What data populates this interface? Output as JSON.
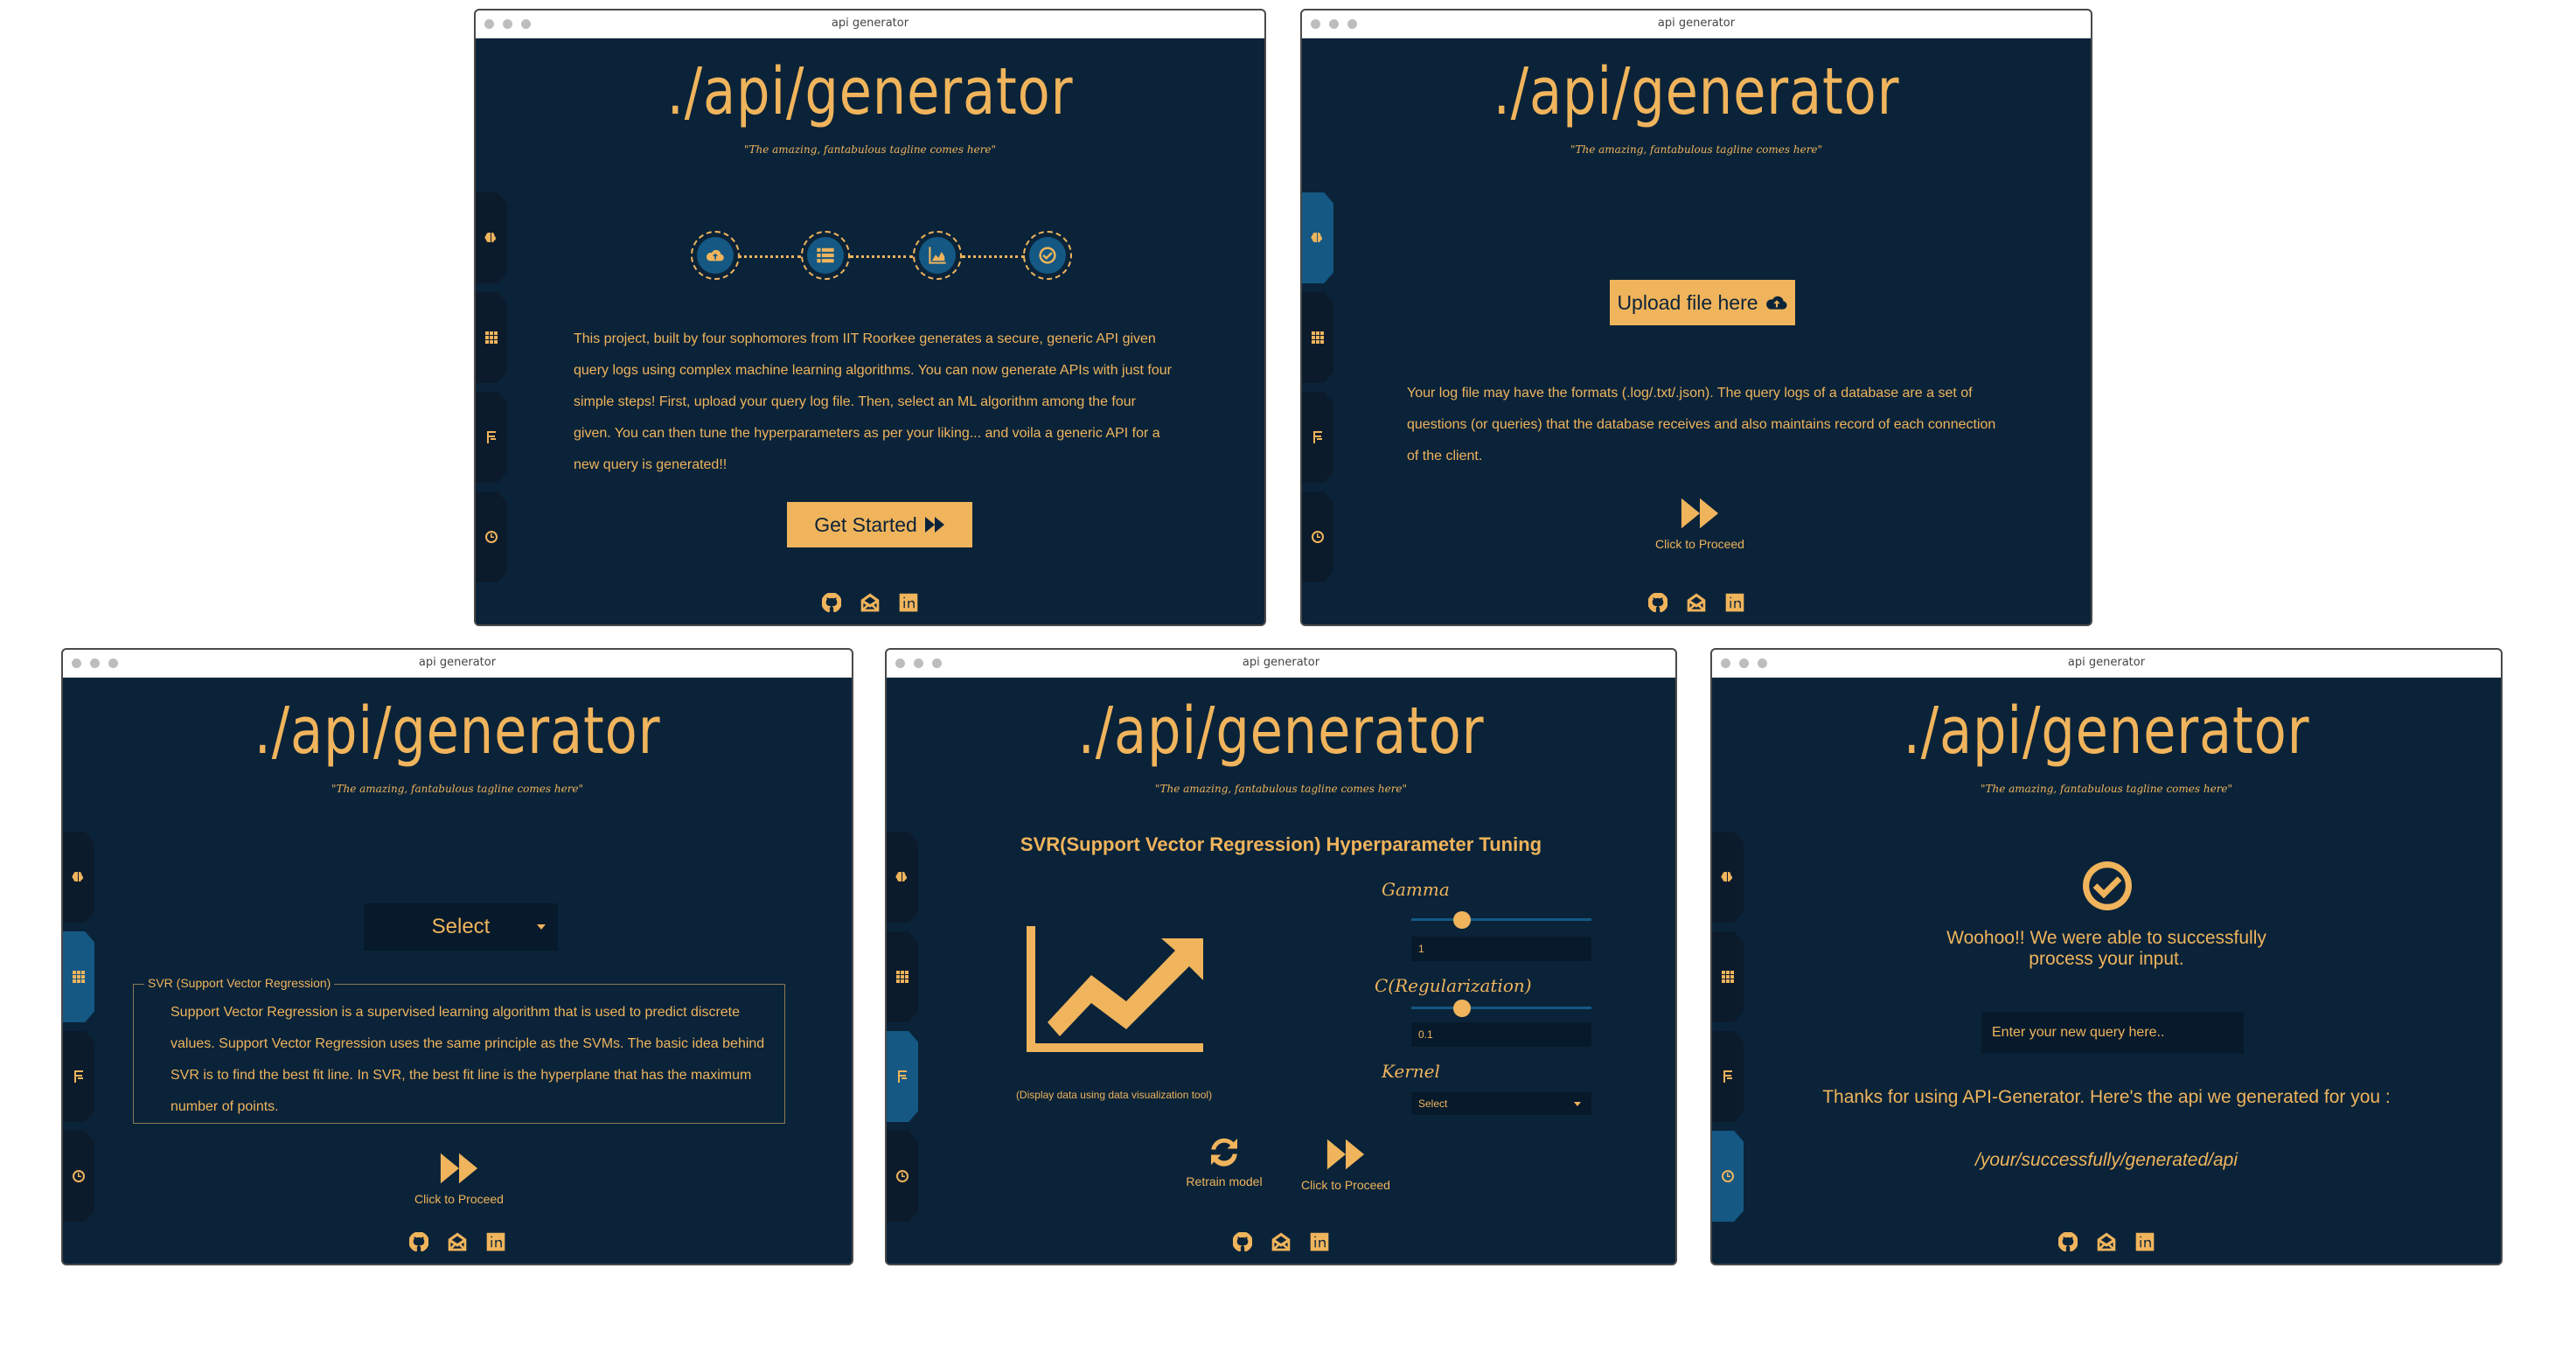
{
  "window_title": "api generator",
  "app": {
    "title": "./api/generator",
    "tagline": "\"The amazing, fantabulous tagline comes here\""
  },
  "nav_icons": [
    "brain-icon",
    "grid-icon",
    "flag-document-icon",
    "clock-icon"
  ],
  "footer_icons": [
    "github-icon",
    "mail-icon",
    "linkedin-icon"
  ],
  "colors": {
    "background": "#0a2339",
    "accent": "#f0b45c",
    "active_tab": "#145883",
    "sidebar": "#0c1b2b"
  },
  "screen_home": {
    "steps": [
      "cloud-upload-icon",
      "list-icon",
      "chart-icon",
      "check-circle-icon"
    ],
    "description": "This project, built by four sophomores from IIT Roorkee generates a secure, generic API given query logs using complex machine learning algorithms. You can now generate APIs with just four simple steps! First, upload your query log file. Then, select an ML algorithm among the four given. You can then tune the hyperparameters as per your liking... and voila a generic API for a new query is generated!!",
    "button": "Get Started"
  },
  "screen_upload": {
    "button": "Upload file here",
    "description": "Your log file may have the formats (.log/.txt/.json). The query logs of a database are a set of questions (or queries) that the database receives and also maintains record of each connection of the client.",
    "proceed": "Click to Proceed"
  },
  "screen_select": {
    "select_label": "Select",
    "fieldset_legend": "SVR (Support Vector Regression)",
    "description": "Support Vector Regression is a supervised learning algorithm that is used to predict discrete values. Support Vector Regression uses the same principle as the SVMs. The basic idea behind SVR is to find the best fit line. In SVR, the best fit line is the hyperplane that has the maximum number of points.",
    "proceed": "Click to Proceed"
  },
  "screen_tune": {
    "heading": "SVR(Support Vector Regression) Hyperparameter Tuning",
    "chart_caption": "(Display data using data visualization tool)",
    "gamma_label": "Gamma",
    "gamma_value": "1",
    "gamma_slider_fraction": 0.28,
    "c_label": "C(Regularization)",
    "c_value": "0.1",
    "c_slider_fraction": 0.28,
    "kernel_label": "Kernel",
    "kernel_select": "Select",
    "retrain": "Retrain model",
    "proceed": "Click to Proceed"
  },
  "screen_done": {
    "success_line1": "Woohoo!! We were able to successfully",
    "success_line2": "process your input.",
    "query_placeholder": "Enter your new query here..",
    "thanks": "Thanks for using API-Generator. Here's the api we generated for you :",
    "api_path": "/your/successfully/generated/api"
  }
}
